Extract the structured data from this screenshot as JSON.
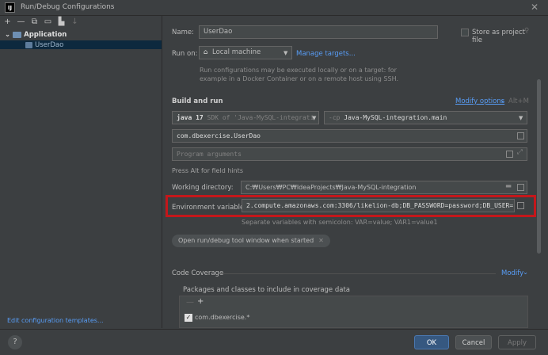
{
  "window": {
    "title": "Run/Debug Configurations",
    "app_icon": "IJ"
  },
  "sidebar": {
    "toolbar": [
      "+",
      "—",
      "⧉",
      "💾",
      "⇆",
      "↓⁼"
    ],
    "tree": {
      "group": "Application",
      "item": "UserDao"
    },
    "edit_templates": "Edit configuration templates..."
  },
  "form": {
    "name_label": "Name:",
    "name_value": "UserDao",
    "store_label": "Store as project file",
    "run_on_label": "Run on:",
    "run_on_value": "Local machine",
    "manage_targets": "Manage targets...",
    "run_on_desc1": "Run configurations may be executed locally or on a target: for",
    "run_on_desc2": "example in a Docker Container or on a remote host using SSH.",
    "build_run_title": "Build and run",
    "modify_options": "Modify options",
    "modify_shortcut": "Alt+M",
    "sdk_java": "java 17",
    "sdk_text": "SDK of 'Java-MySQL-integrati",
    "cp_flag": "-cp",
    "cp_value": "Java-MySQL-integration.main",
    "main_class": "com.dbexercise.UserDao",
    "program_args_placeholder": "Program arguments",
    "alt_hint": "Press Alt for field hints",
    "working_dir_label": "Working directory:",
    "working_dir_value": "C:₩Users₩PC₩IdeaProjects₩Java-MySQL-integration",
    "env_label": "Environment variables:",
    "env_value": "2.compute.amazonaws.com:3306/likelion-db;DB_PASSWORD=password;DB_USER=root",
    "env_hint": "Separate variables with semicolon: VAR=value; VAR1=value1",
    "open_tool_window": "Open run/debug tool window when started",
    "code_coverage": "Code Coverage",
    "modify": "Modify",
    "packages_label": "Packages and classes to include in coverage data",
    "coverage_item": "com.dbexercise.*"
  },
  "buttons": {
    "help": "?",
    "ok": "OK",
    "cancel": "Cancel",
    "apply": "Apply"
  },
  "colors": {
    "accent": "#365880",
    "link": "#589df6",
    "highlight": "#c4171b"
  }
}
